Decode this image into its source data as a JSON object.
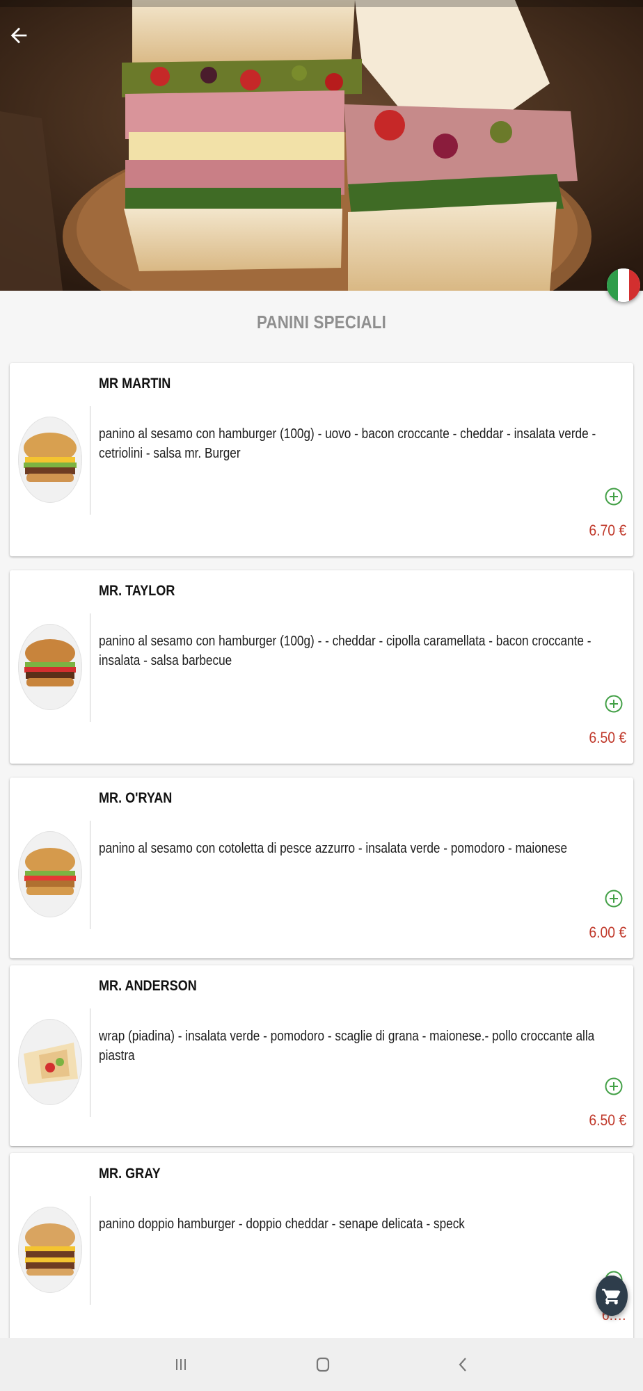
{
  "header": {
    "back_icon": "arrow-left-icon",
    "language_icon": "italy-flag-icon"
  },
  "section": {
    "title": "PANINI SPECIALI"
  },
  "products": [
    {
      "name": "MR MARTIN",
      "description": "panino al sesamo con hamburger (100g) - uovo - bacon croccante - cheddar - insalata verde - cetriolini - salsa mr. Burger",
      "price": "6.70 €",
      "image": "burger-with-egg"
    },
    {
      "name": "MR. TAYLOR",
      "description": "panino al sesamo con hamburger (100g) -  - cheddar - cipolla caramellata - bacon croccante - insalata - salsa barbecue",
      "price": "6.50 €",
      "image": "bbq-burger"
    },
    {
      "name": "MR. O'RYAN",
      "description": "panino al sesamo con cotoletta di pesce azzurro - insalata verde - pomodoro - maionese",
      "price": "6.00 €",
      "image": "fish-burger"
    },
    {
      "name": "MR. ANDERSON",
      "description": "wrap (piadina) - insalata verde - pomodoro - scaglie di grana - maionese.- pollo croccante alla piastra",
      "price": "6.50 €",
      "image": "chicken-wrap"
    },
    {
      "name": "MR. GRAY",
      "description": "panino doppio hamburger - doppio cheddar - senape delicata - speck",
      "price": "6.…",
      "image": "double-burger"
    }
  ],
  "cart": {
    "icon": "shopping-cart-icon"
  },
  "system_nav": {
    "recents_icon": "recents-icon",
    "home_icon": "home-icon",
    "back_icon": "nav-back-icon"
  },
  "colors": {
    "price": "#c0392b",
    "add_icon": "#43a047",
    "title_gray": "#8f8f8f",
    "fab": "#2e3d4b"
  }
}
